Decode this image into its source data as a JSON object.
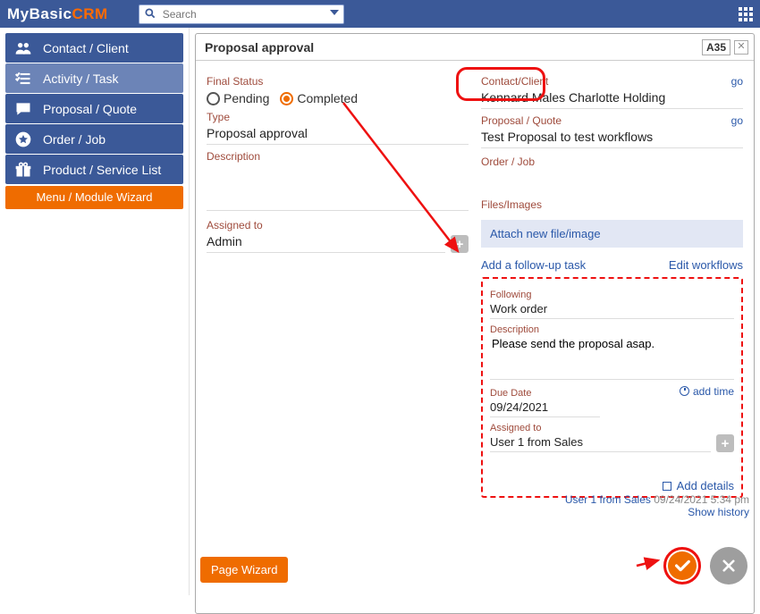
{
  "brand": {
    "a": "MyBasic",
    "b": "CRM"
  },
  "search": {
    "placeholder": "Search"
  },
  "sidebar": {
    "items": [
      {
        "label": "Contact / Client"
      },
      {
        "label": "Activity / Task"
      },
      {
        "label": "Proposal / Quote"
      },
      {
        "label": "Order / Job"
      },
      {
        "label": "Product / Service List"
      }
    ],
    "wizard": "Menu / Module Wizard"
  },
  "card": {
    "title": "Proposal approval",
    "code": "A35",
    "finalStatusLabel": "Final Status",
    "pending": "Pending",
    "completed": "Completed",
    "typeLabel": "Type",
    "typeValue": "Proposal approval",
    "descLabel": "Description",
    "assignedLabel": "Assigned to",
    "assignedValue": "Admin",
    "contactLabel": "Contact/Client",
    "contactValue": "Kennard Males Charlotte Holding",
    "proposalLabel": "Proposal / Quote",
    "proposalValue": "Test Proposal to test workflows",
    "orderLabel": "Order / Job",
    "filesLabel": "Files/Images",
    "attach": "Attach new file/image",
    "addFollowup": "Add a follow-up task",
    "editWorkflows": "Edit workflows",
    "go": "go"
  },
  "followup": {
    "followingLabel": "Following",
    "followingValue": "Work order",
    "descLabel": "Description",
    "descValue": "Please send the proposal asap.",
    "dueLabel": "Due Date",
    "dueValue": "09/24/2021",
    "addTime": "add time",
    "assignedLabel": "Assigned to",
    "assignedValue": "User 1 from Sales",
    "addDetails": "Add details"
  },
  "audit": {
    "who": "User 1 from Sales",
    "when": "09/24/2021 5:34 pm",
    "showHistory": "Show history"
  },
  "pageWizard": "Page Wizard"
}
